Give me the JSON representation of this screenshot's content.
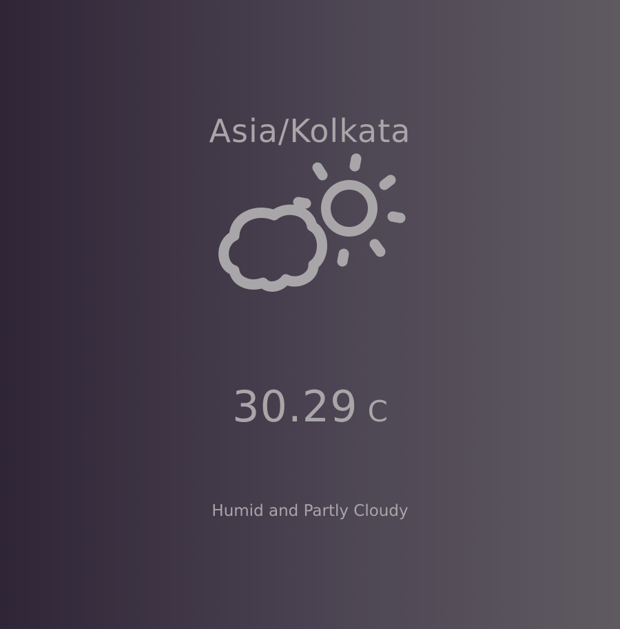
{
  "weather": {
    "timezone": "Asia/Kolkata",
    "icon": "partly-cloudy-day-icon",
    "temperature": "30.29",
    "unit": "C",
    "condition": "Humid and Partly Cloudy"
  },
  "colors": {
    "text": "#a8a6a9",
    "icon": "#a8a6a9",
    "background_left": "#2e2536",
    "background_right": "#5f5a61"
  }
}
